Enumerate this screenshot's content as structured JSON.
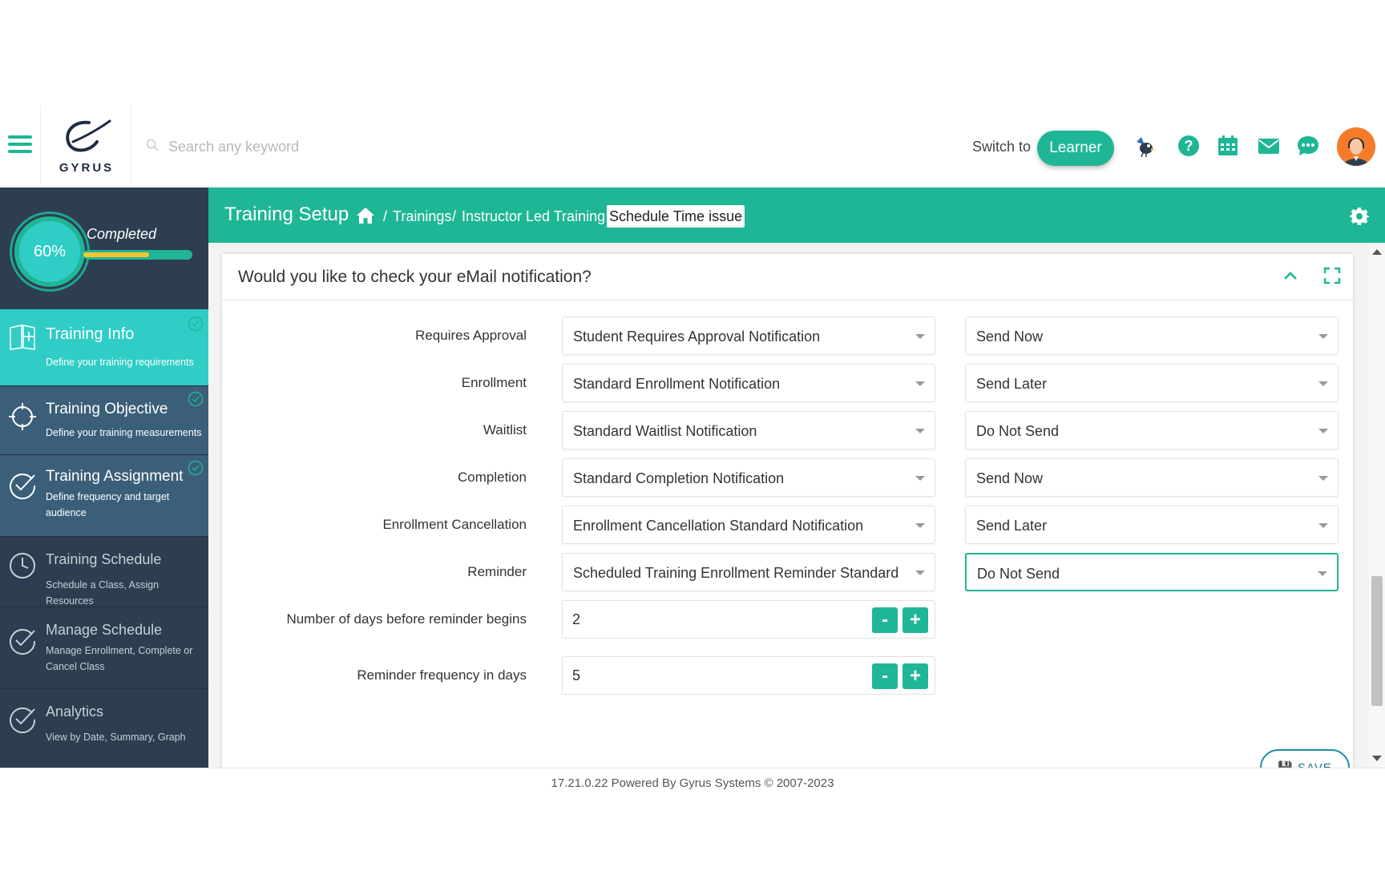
{
  "header": {
    "search_placeholder": "Search any keyword",
    "logo_text": "GYRUS",
    "switch_label": "Switch to",
    "learner_button": "Learner",
    "accent_color": "#1fb696"
  },
  "sidebar": {
    "progress_percent": "60%",
    "progress_value": 0.6,
    "completed_label": "Completed",
    "items": [
      {
        "title": "Training Info",
        "subtitle": "Define your training requirements",
        "icon": "book-plus-icon",
        "state": "active"
      },
      {
        "title": "Training Objective",
        "subtitle": "Define your training measurements",
        "icon": "crosshair-icon",
        "state": "done"
      },
      {
        "title": "Training Assignment",
        "subtitle": "Define frequency and target audience",
        "icon": "check-circle-icon",
        "state": "done"
      },
      {
        "title": "Training Schedule",
        "subtitle": "Schedule a Class, Assign Resources",
        "icon": "clock-icon",
        "state": "pending"
      },
      {
        "title": "Manage Schedule",
        "subtitle": "Manage Enrollment, Complete or Cancel Class",
        "icon": "check-circle-icon",
        "state": "pending"
      },
      {
        "title": "Analytics",
        "subtitle": "View by Date, Summary, Graph",
        "icon": "check-circle-icon",
        "state": "pending"
      }
    ]
  },
  "titlebar": {
    "title": "Training Setup",
    "breadcrumb": {
      "sep": "/",
      "trainings": "Trainings",
      "instructor_led": "Instructor Led Training",
      "current": "Schedule Time issue"
    }
  },
  "panel": {
    "title": "Would you like to check your eMail notification?",
    "rows": [
      {
        "label": "Requires Approval",
        "template": "Student Requires Approval Notification",
        "send": "Send Now"
      },
      {
        "label": "Enrollment",
        "template": "Standard Enrollment Notification",
        "send": "Send Later"
      },
      {
        "label": "Waitlist",
        "template": "Standard Waitlist Notification",
        "send": "Do Not Send"
      },
      {
        "label": "Completion",
        "template": "Standard Completion Notification",
        "send": "Send Now"
      },
      {
        "label": "Enrollment Cancellation",
        "template": "Enrollment Cancellation Standard Notification",
        "send": "Send Later"
      },
      {
        "label": "Reminder",
        "template": "Scheduled Training Enrollment Reminder Standard",
        "send": "Do Not Send"
      }
    ],
    "reminder_days": {
      "label": "Number of days before reminder begins",
      "value": "2"
    },
    "reminder_frequency": {
      "label": "Reminder frequency in days",
      "value": "5"
    },
    "minus": "-",
    "plus": "+",
    "save_label": "SAVE"
  },
  "footer": {
    "text": "17.21.0.22 Powered By Gyrus Systems © 2007-2023"
  }
}
